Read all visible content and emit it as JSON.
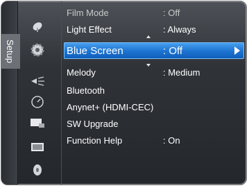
{
  "tab_label": "Setup",
  "menu": {
    "items": [
      {
        "label": "Film Mode",
        "value": ": Off"
      },
      {
        "label": "Light Effect",
        "value": ": Always"
      },
      {
        "label": "Blue Screen",
        "value": ": Off"
      },
      {
        "label": "Melody",
        "value": ": Medium"
      },
      {
        "label": "Bluetooth",
        "value": ""
      },
      {
        "label": "Anynet+ (HDMI-CEC)",
        "value": ""
      },
      {
        "label": "SW Upgrade",
        "value": ""
      },
      {
        "label": "Function Help",
        "value": ": On"
      }
    ],
    "selected_index": 2
  },
  "icons": [
    "satellite-dish-icon",
    "setup-gear-icon",
    "sound-speaker-icon",
    "clock-icon",
    "input-icon",
    "picture-icon",
    "disc-icon"
  ],
  "colors": {
    "highlight": "#1c73cf",
    "panel": "#303338"
  }
}
